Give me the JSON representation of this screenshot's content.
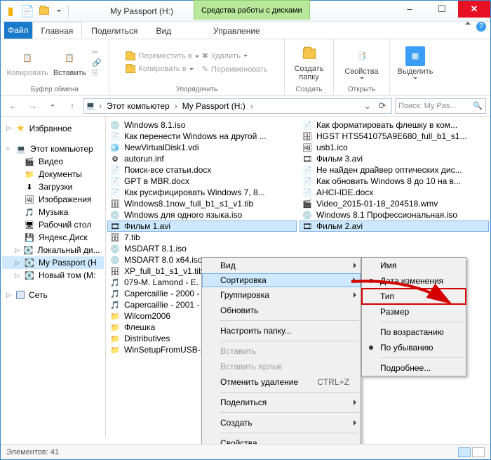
{
  "titlebar": {
    "title": "My Passport (H:)",
    "tools_tab": "Средства работы с дисками"
  },
  "tabs": {
    "file": "Файл",
    "main": "Главная",
    "share": "Поделиться",
    "view": "Вид",
    "manage": "Управление"
  },
  "ribbon": {
    "copy": "Копировать",
    "paste": "Вставить",
    "move": "Переместить в",
    "copy_to": "Копировать в",
    "delete": "Удалить",
    "rename": "Переименовать",
    "new_folder": "Создать\nпапку",
    "properties": "Свойства",
    "select": "Выделить",
    "grp_clipboard": "Буфер обмена",
    "grp_organize": "Упорядочить",
    "grp_new": "Создать",
    "grp_open": "Открыть"
  },
  "addr": {
    "crumb1": "Этот компьютер",
    "crumb2": "My Passport (H:)",
    "search_placeholder": "Поиск: My Pas..."
  },
  "nav": {
    "favorites": "Избранное",
    "thispc": "Этот компьютер",
    "items": [
      "Видео",
      "Документы",
      "Загрузки",
      "Изображения",
      "Музыка",
      "Рабочий стол",
      "Яндекс.Диск",
      "Локальный ди...",
      "My Passport (H",
      "Новый том (M:"
    ],
    "network": "Сеть"
  },
  "files_col1": [
    {
      "n": "Windows 8.1.iso",
      "i": "💿"
    },
    {
      "n": "Как перенести Windows на другой ...",
      "i": "📄"
    },
    {
      "n": "NewVirtualDisk1.vdi",
      "i": "🧊"
    },
    {
      "n": "autorun.inf",
      "i": "⚙"
    },
    {
      "n": "Поиск-все статьи.docx",
      "i": "📄"
    },
    {
      "n": "GPT в MBR.docx",
      "i": "📄"
    },
    {
      "n": "Как русифицировать Windows 7, 8...",
      "i": "📄"
    },
    {
      "n": "Windows8.1now_full_b1_s1_v1.tib",
      "i": "🗄"
    },
    {
      "n": "Windows для одного языка.iso",
      "i": "💿"
    },
    {
      "n": "Фильм 1.avi",
      "i": "🎞",
      "sel": true
    },
    {
      "n": "7.tib",
      "i": "🗄"
    },
    {
      "n": "MSDART 8.1.iso",
      "i": "💿"
    },
    {
      "n": "MSDART 8.0 x64.iso",
      "i": "💿"
    },
    {
      "n": "XP_full_b1_s1_v1.tib",
      "i": "🗄"
    },
    {
      "n": "079-M. Lamond - E. H...",
      "i": "🎵"
    },
    {
      "n": "Capercaillie - 2000 - Na...",
      "i": "🎵"
    },
    {
      "n": "Capercaillie - 2001 - A...",
      "i": "🎵"
    },
    {
      "n": "Wilcom2006",
      "i": "📁"
    },
    {
      "n": "Флешка",
      "i": "📁"
    },
    {
      "n": "Distributives",
      "i": "📁"
    },
    {
      "n": "WinSetupFromUSB-1-...",
      "i": "📁"
    }
  ],
  "files_col2": [
    {
      "n": "Как форматировать флешку в ком...",
      "i": "📄"
    },
    {
      "n": "HGST HTS541075A9E680_full_b1_s1...",
      "i": "🗄"
    },
    {
      "n": "usb1.ico",
      "i": "🖼"
    },
    {
      "n": "Фильм 3.avi",
      "i": "🎞"
    },
    {
      "n": "Не найден драйвер оптических дис...",
      "i": "📄"
    },
    {
      "n": "Как обновить Windows 8 до 10 на в...",
      "i": "📄"
    },
    {
      "n": "AHCI-IDE.docx",
      "i": "📄"
    },
    {
      "n": "Video_2015-01-18_204518.wmv",
      "i": "🎬"
    },
    {
      "n": "Windows 8.1 Профессиональная.iso",
      "i": "💿"
    },
    {
      "n": "Фильм 2.avi",
      "i": "🎞",
      "sel": true
    }
  ],
  "ctx_main": {
    "view": "Вид",
    "sort": "Сортировка",
    "group": "Группировка",
    "refresh": "Обновить",
    "customize": "Настроить папку...",
    "paste": "Вставить",
    "paste_lnk": "Вставить ярлык",
    "undo": "Отменить удаление",
    "undo_key": "CTRL+Z",
    "share": "Поделиться",
    "new": "Создать",
    "props": "Свойства"
  },
  "ctx_sort": {
    "name": "Имя",
    "date": "Дата изменения",
    "type": "Тип",
    "size": "Размер",
    "asc": "По возрастанию",
    "desc": "По убыванию",
    "more": "Подробнее..."
  },
  "status": {
    "count_label": "Элементов:",
    "count": "41"
  }
}
